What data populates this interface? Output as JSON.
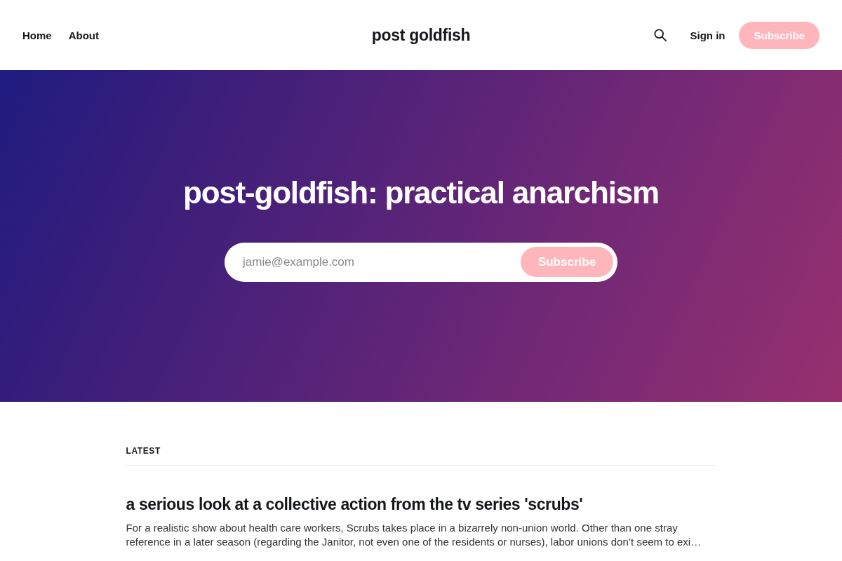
{
  "header": {
    "nav": [
      {
        "label": "Home"
      },
      {
        "label": "About"
      }
    ],
    "site_title": "post goldfish",
    "sign_in": "Sign in",
    "subscribe": "Subscribe"
  },
  "hero": {
    "title": "post-goldfish: practical anarchism",
    "form": {
      "placeholder": "jamie@example.com",
      "button": "Subscribe"
    }
  },
  "feed": {
    "heading": "LATEST",
    "posts": [
      {
        "title": "a serious look at a collective action from the tv series 'scrubs'",
        "excerpt": "For a realistic show about health care workers, Scrubs takes place in a bizarrely non-union world. Other than one stray reference in a later season (regarding the Janitor, not even one of the residents or nurses), labor unions don’t seem to exi…"
      }
    ]
  }
}
